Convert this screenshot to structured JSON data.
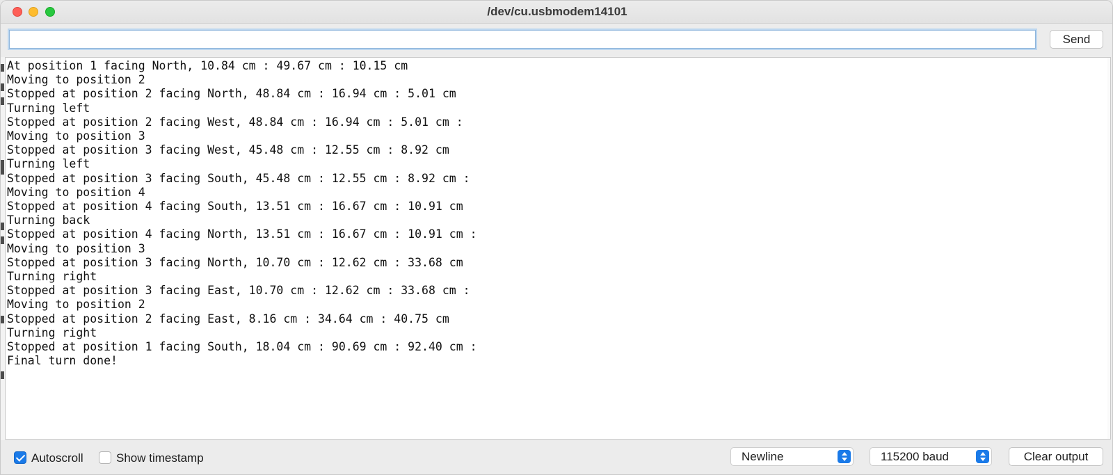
{
  "window": {
    "title": "/dev/cu.usbmodem14101"
  },
  "input": {
    "value": "",
    "send_label": "Send"
  },
  "output": {
    "lines": [
      "At position 1 facing North, 10.84 cm : 49.67 cm : 10.15 cm",
      "Moving to position 2",
      "Stopped at position 2 facing North, 48.84 cm : 16.94 cm : 5.01 cm",
      "Turning left",
      "Stopped at position 2 facing West, 48.84 cm : 16.94 cm : 5.01 cm :",
      "Moving to position 3",
      "Stopped at position 3 facing West, 45.48 cm : 12.55 cm : 8.92 cm",
      "Turning left",
      "Stopped at position 3 facing South, 45.48 cm : 12.55 cm : 8.92 cm :",
      "Moving to position 4",
      "Stopped at position 4 facing South, 13.51 cm : 16.67 cm : 10.91 cm",
      "Turning back",
      "Stopped at position 4 facing North, 13.51 cm : 16.67 cm : 10.91 cm :",
      "Moving to position 3",
      "Stopped at position 3 facing North, 10.70 cm : 12.62 cm : 33.68 cm",
      "Turning right",
      "Stopped at position 3 facing East, 10.70 cm : 12.62 cm : 33.68 cm :",
      "Moving to position 2",
      "Stopped at position 2 facing East, 8.16 cm : 34.64 cm : 40.75 cm",
      "Turning right",
      "Stopped at position 1 facing South, 18.04 cm : 90.69 cm : 92.40 cm :",
      "Final turn done!"
    ]
  },
  "footer": {
    "autoscroll": {
      "label": "Autoscroll",
      "checked": true
    },
    "timestamp": {
      "label": "Show timestamp",
      "checked": false
    },
    "line_ending": "Newline",
    "baud": "115200 baud",
    "clear_label": "Clear output"
  },
  "colors": {
    "accent": "#1a7ae8",
    "close": "#fe5f57",
    "minimize": "#febc2e",
    "maximize": "#28c840"
  }
}
